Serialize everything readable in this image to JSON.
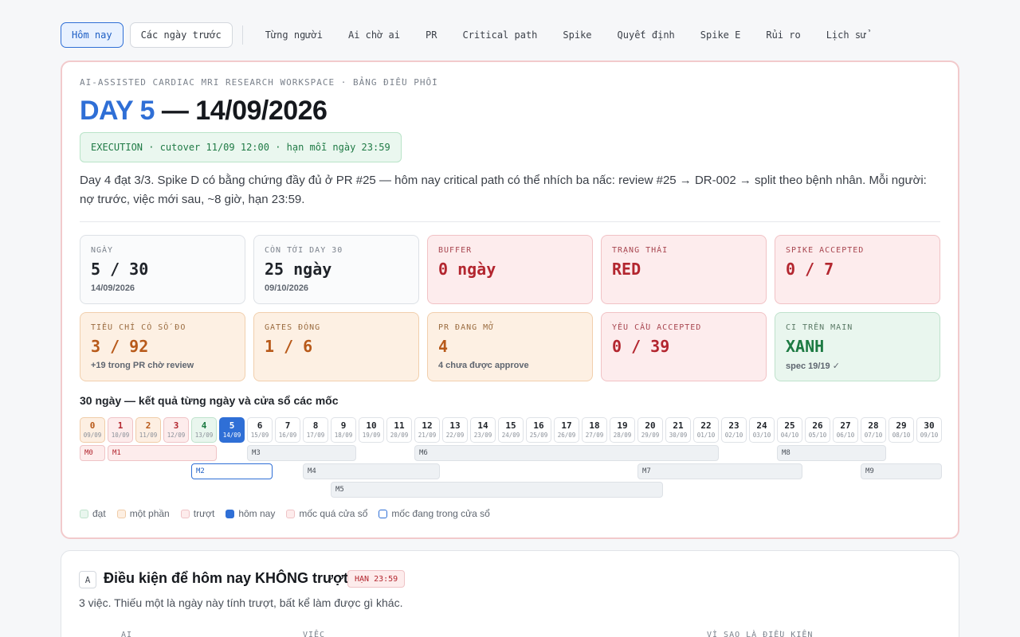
{
  "nav": {
    "buttons": [
      "Hôm nay",
      "Các ngày trước"
    ],
    "links": [
      "Từng người",
      "Ai chờ ai",
      "PR",
      "Critical path",
      "Spike",
      "Quyết định",
      "Spike E",
      "Rủi ro",
      "Lịch sử"
    ]
  },
  "header": {
    "eyebrow": "AI-ASSISTED CARDIAC MRI RESEARCH WORKSPACE · BẢNG ĐIỀU PHỐI",
    "day_label": "DAY 5",
    "date_label": " — 14/09/2026",
    "phase": "EXECUTION · cutover 11/09 12:00 · hạn mỗi ngày 23:59",
    "summary": "Day 4 đạt 3/3. Spike D có bằng chứng đầy đủ ở PR #25 — hôm nay critical path có thể nhích ba nấc: review #25 → DR-002 → split theo bệnh nhân. Mỗi người: nợ trước, việc mới sau, ~8 giờ, hạn 23:59."
  },
  "stats": [
    {
      "label": "NGÀY",
      "value": "5 / 30",
      "sub": "14/09/2026",
      "tone": "neutral"
    },
    {
      "label": "CÒN TỚI DAY 30",
      "value": "25 ngày",
      "sub": "09/10/2026",
      "tone": "neutral"
    },
    {
      "label": "BUFFER",
      "value": "0 ngày",
      "sub": "",
      "tone": "red"
    },
    {
      "label": "TRẠNG THÁI",
      "value": "RED",
      "sub": "",
      "tone": "red"
    },
    {
      "label": "SPIKE ACCEPTED",
      "value": "0 / 7",
      "sub": "",
      "tone": "red"
    },
    {
      "label": "TIÊU CHÍ CÓ SỐ ĐO",
      "value": "3 / 92",
      "sub": "+19 trong PR chờ review",
      "tone": "orange"
    },
    {
      "label": "GATES ĐÓNG",
      "value": "1 / 6",
      "sub": "",
      "tone": "orange"
    },
    {
      "label": "PR ĐANG MỞ",
      "value": "4",
      "sub": "4 chưa được approve",
      "tone": "orange"
    },
    {
      "label": "YÊU CẦU ACCEPTED",
      "value": "0 / 39",
      "sub": "",
      "tone": "red"
    },
    {
      "label": "CI TRÊN MAIN",
      "value": "XANH",
      "sub": "spec 19/19 ✓",
      "tone": "green"
    }
  ],
  "timeline": {
    "title": "30 ngày — kết quả từng ngày và cửa sổ các mốc",
    "days": [
      {
        "n": "0",
        "d": "09/09",
        "s": "partial"
      },
      {
        "n": "1",
        "d": "10/09",
        "s": "miss"
      },
      {
        "n": "2",
        "d": "11/09",
        "s": "partial"
      },
      {
        "n": "3",
        "d": "12/09",
        "s": "miss"
      },
      {
        "n": "4",
        "d": "13/09",
        "s": "ok"
      },
      {
        "n": "5",
        "d": "14/09",
        "s": "today"
      },
      {
        "n": "6",
        "d": "15/09",
        "s": "future"
      },
      {
        "n": "7",
        "d": "16/09",
        "s": "future"
      },
      {
        "n": "8",
        "d": "17/09",
        "s": "future"
      },
      {
        "n": "9",
        "d": "18/09",
        "s": "future"
      },
      {
        "n": "10",
        "d": "19/09",
        "s": "future"
      },
      {
        "n": "11",
        "d": "20/09",
        "s": "future"
      },
      {
        "n": "12",
        "d": "21/09",
        "s": "future"
      },
      {
        "n": "13",
        "d": "22/09",
        "s": "future"
      },
      {
        "n": "14",
        "d": "23/09",
        "s": "future"
      },
      {
        "n": "15",
        "d": "24/09",
        "s": "future"
      },
      {
        "n": "16",
        "d": "25/09",
        "s": "future"
      },
      {
        "n": "17",
        "d": "26/09",
        "s": "future"
      },
      {
        "n": "18",
        "d": "27/09",
        "s": "future"
      },
      {
        "n": "19",
        "d": "28/09",
        "s": "future"
      },
      {
        "n": "20",
        "d": "29/09",
        "s": "future"
      },
      {
        "n": "21",
        "d": "30/09",
        "s": "future"
      },
      {
        "n": "22",
        "d": "01/10",
        "s": "future"
      },
      {
        "n": "23",
        "d": "02/10",
        "s": "future"
      },
      {
        "n": "24",
        "d": "03/10",
        "s": "future"
      },
      {
        "n": "25",
        "d": "04/10",
        "s": "future"
      },
      {
        "n": "26",
        "d": "05/10",
        "s": "future"
      },
      {
        "n": "27",
        "d": "06/10",
        "s": "future"
      },
      {
        "n": "28",
        "d": "07/10",
        "s": "future"
      },
      {
        "n": "29",
        "d": "08/10",
        "s": "future"
      },
      {
        "n": "30",
        "d": "09/10",
        "s": "future"
      }
    ],
    "milestones": [
      {
        "name": "M0",
        "start": 0,
        "end": 0,
        "row": 0,
        "state": "past"
      },
      {
        "name": "M1",
        "start": 1,
        "end": 4,
        "row": 0,
        "state": "past"
      },
      {
        "name": "M3",
        "start": 6,
        "end": 9,
        "row": 0,
        "state": "future"
      },
      {
        "name": "M6",
        "start": 12,
        "end": 22,
        "row": 0,
        "state": "future"
      },
      {
        "name": "M8",
        "start": 25,
        "end": 28,
        "row": 0,
        "state": "future"
      },
      {
        "name": "M2",
        "start": 4,
        "end": 6,
        "row": 1,
        "state": "inwin"
      },
      {
        "name": "M4",
        "start": 8,
        "end": 12,
        "row": 1,
        "state": "future"
      },
      {
        "name": "M7",
        "start": 20,
        "end": 25,
        "row": 1,
        "state": "future"
      },
      {
        "name": "M9",
        "start": 28,
        "end": 30,
        "row": 1,
        "state": "future"
      },
      {
        "name": "M5",
        "start": 9,
        "end": 20,
        "row": 2,
        "state": "future"
      }
    ],
    "legend": [
      {
        "label": "đạt",
        "cls": "ok"
      },
      {
        "label": "một phần",
        "cls": "partial"
      },
      {
        "label": "trượt",
        "cls": "miss"
      },
      {
        "label": "hôm nay",
        "cls": "today"
      },
      {
        "label": "mốc quá cửa sổ",
        "cls": "past"
      },
      {
        "label": "mốc đang trong cửa sổ",
        "cls": "inwin"
      }
    ]
  },
  "sectionA": {
    "badge": "A",
    "title": "Điều kiện để hôm nay KHÔNG trượt",
    "deadline": "HẠN 23:59",
    "desc": "3 việc. Thiếu một là ngày này tính trượt, bất kể làm được gì khác.",
    "columns": [
      "AI",
      "VIỆC",
      "VÌ SAO LÀ ĐIỀU KIỆN"
    ]
  }
}
